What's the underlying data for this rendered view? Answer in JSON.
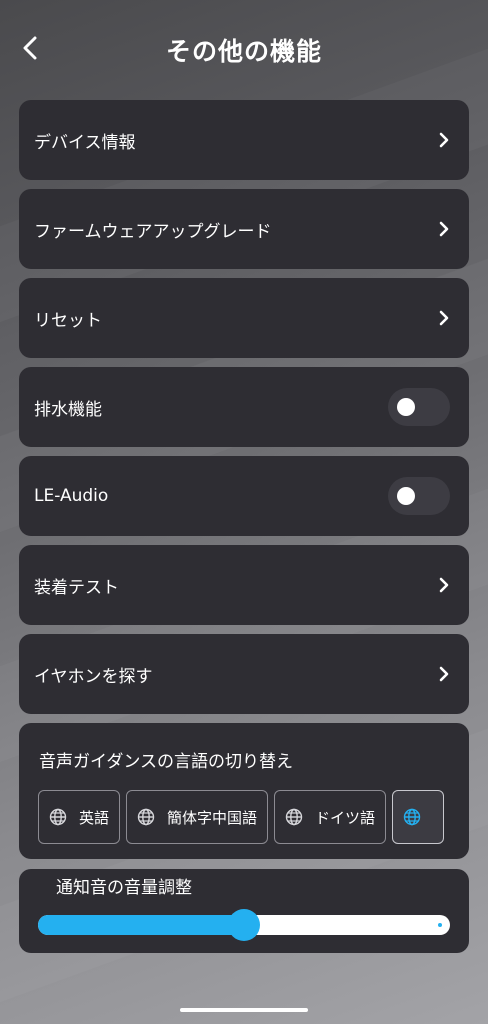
{
  "header": {
    "title": "その他の機能"
  },
  "items": [
    {
      "label": "デバイス情報",
      "control": "chevron"
    },
    {
      "label": "ファームウェアアップグレード",
      "control": "chevron"
    },
    {
      "label": "リセット",
      "control": "chevron"
    },
    {
      "label": "排水機能",
      "control": "toggle",
      "on": false
    },
    {
      "label": "LE-Audio",
      "control": "toggle",
      "on": false
    },
    {
      "label": "装着テスト",
      "control": "chevron"
    },
    {
      "label": "イヤホンを探す",
      "control": "chevron"
    }
  ],
  "voice_guidance": {
    "title": "音声ガイダンスの言語の切り替え",
    "options": [
      {
        "label": "英語",
        "selected": false
      },
      {
        "label": "簡体字中国語",
        "selected": false
      },
      {
        "label": "ドイツ語",
        "selected": false
      },
      {
        "label": "",
        "selected": true
      }
    ]
  },
  "notification_volume": {
    "title": "通知音の音量調整",
    "value_fraction": 0.5
  },
  "colors": {
    "accent": "#24b0f0",
    "card_bg": "#2e2d33",
    "selected_globe": "#24b0f0"
  },
  "icons": {
    "back": "chevron-left-icon",
    "row_chevron": "chevron-right-icon",
    "language": "globe-icon"
  }
}
